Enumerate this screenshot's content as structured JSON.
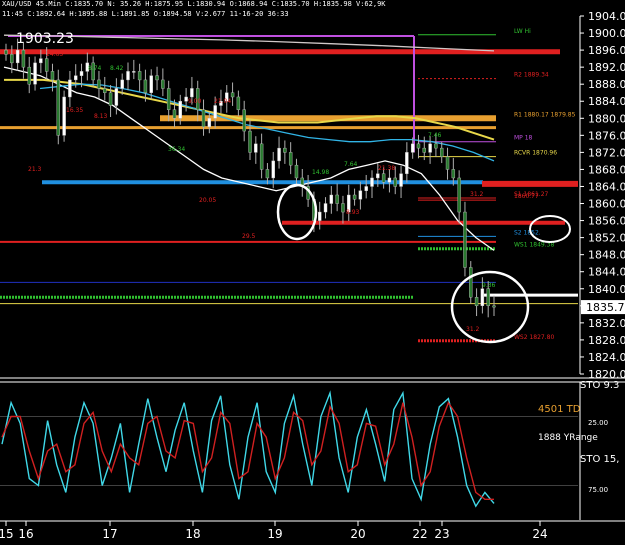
{
  "header": {
    "text": "XAU/USD 45.Min C:1835.70 N: 35.26 H:1875.95 L:1830.94 O:1868.94 C:1835.70 H:1835.98 V:62,9K",
    "subtext": "11:45 C:1892.64 H:1895.88 L:1891.85 O:1894.58 V:2.677 11-16-20 36:33",
    "big_price": "1903.23"
  },
  "colors": {
    "background": "#000000",
    "axis_text": "#ffffff",
    "candle_up": "#ffffff",
    "candle_down": "#ffffff",
    "ma_white": "#ffffff",
    "ma_yellow": "#e8d84a",
    "ma_cyan": "#31b4e6",
    "ma_orange": "#e8a030",
    "ma_purple": "#c050e0",
    "level_red": "#e02020",
    "level_blue": "#2090e0",
    "level_green": "#30c030",
    "osc_cyan": "#40d8e8",
    "osc_red": "#d02020"
  },
  "chart_data": [
    {
      "type": "line",
      "title": "XAU/USD 45.Min",
      "y_ticks": [
        1820.0,
        1824.0,
        1828.0,
        1832.0,
        1836.0,
        1840.0,
        1844.0,
        1848.0,
        1852.0,
        1856.0,
        1860.0,
        1864.0,
        1868.0,
        1872.0,
        1876.0,
        1880.0,
        1884.0,
        1888.0,
        1892.0,
        1896.0,
        1900.0,
        1904.0
      ],
      "ylim": [
        1820,
        1904
      ],
      "last_price": "1835.70",
      "x_ticks": [
        "15",
        "16",
        "17",
        "18",
        "19",
        "20",
        "22",
        "23",
        "24"
      ],
      "series": [
        {
          "style": "candles",
          "values": [
            1895,
            1893,
            1896,
            1892,
            1888,
            1893,
            1894,
            1891,
            1889,
            1876,
            1885,
            1889,
            1890,
            1891,
            1893,
            1889,
            1887,
            1886,
            1883,
            1887,
            1889,
            1891,
            1891,
            1889,
            1886,
            1890,
            1889,
            1887,
            1882,
            1880,
            1884,
            1885,
            1887,
            1882,
            1878,
            1880,
            1883,
            1884,
            1886,
            1885,
            1882,
            1877,
            1872,
            1874,
            1868,
            1866,
            1870,
            1873,
            1872,
            1869,
            1866,
            1864,
            1861,
            1856,
            1858,
            1860,
            1862,
            1860,
            1858,
            1862,
            1861,
            1863,
            1864,
            1866,
            1867,
            1865,
            1866,
            1864,
            1867,
            1872,
            1874,
            1873,
            1872,
            1874,
            1873,
            1871,
            1868,
            1866,
            1858,
            1845,
            1838,
            1836,
            1840,
            1836,
            1835.7
          ]
        },
        {
          "style": "ma_white",
          "values": [
            1892,
            1891,
            1890,
            1888,
            1886,
            1885,
            1883,
            1880,
            1877,
            1874,
            1871,
            1868,
            1866,
            1865,
            1864,
            1863,
            1864,
            1865,
            1866,
            1868,
            1869,
            1870,
            1869,
            1867,
            1862,
            1856,
            1852,
            1849
          ]
        },
        {
          "style": "ma_yellow",
          "values": [
            1889,
            1889,
            1889,
            1888.5,
            1888,
            1887,
            1886,
            1885,
            1884,
            1883,
            1882,
            1881,
            1880,
            1879.5,
            1879,
            1879,
            1879,
            1879.5,
            1880,
            1880.5,
            1880.5,
            1880,
            1879,
            1878,
            1876.5,
            1875
          ]
        },
        {
          "style": "ma_cyan",
          "values": [
            1887,
            1887.5,
            1888,
            1887.8,
            1887,
            1886,
            1884.5,
            1883,
            1881.5,
            1880,
            1878.5,
            1877.5,
            1876.5,
            1875.5,
            1875,
            1874.5,
            1874.5,
            1875,
            1875,
            1874.5,
            1873.5,
            1872,
            1870
          ]
        },
        {
          "style": "ma_gray",
          "values": [
            1899.5,
            1899.3,
            1899,
            1898.7,
            1898.4,
            1898,
            1897.5,
            1897,
            1896.4,
            1895.8
          ]
        }
      ],
      "levels": [
        {
          "label": "LW Hi",
          "value": 1899.6
        },
        {
          "label": "",
          "value": 1895.6
        },
        {
          "label": "R2 1889.34",
          "value": 1889.3
        },
        {
          "label": "R1 1880.17  1879.85",
          "value": 1880.0
        },
        {
          "label": "",
          "value": 1877.8
        },
        {
          "label": "MP 18",
          "value": 1874.5
        },
        {
          "label": "RCVR 1870.96",
          "value": 1871.0
        },
        {
          "label": "",
          "value": 1865.0
        },
        {
          "label": "S1 1861.27",
          "value": 1861.3
        },
        {
          "label": "1860.77",
          "value": 1860.8
        },
        {
          "label": "",
          "value": 1855.5
        },
        {
          "label": "S2 1852.",
          "value": 1852.3
        },
        {
          "label": "",
          "value": 1851.0
        },
        {
          "label": "WS1 1849.38",
          "value": 1849.4
        },
        {
          "label": "",
          "value": 1841.5
        },
        {
          "label": "",
          "value": 1838.0
        },
        {
          "label": "",
          "value": 1836.5
        },
        {
          "label": "WS2 1827.80",
          "value": 1827.8
        }
      ],
      "annotations": [
        "24.63",
        "8.74",
        "8.42",
        "16.35",
        "21.3",
        "8.13",
        "9.00",
        "21.04",
        "36.34",
        "20.05",
        "29.5",
        "14.98",
        "7.64",
        "8.93",
        "21.38",
        "7.46",
        "31.2",
        "9.36",
        "31.2"
      ]
    },
    {
      "type": "line",
      "title": "STO",
      "labels": [
        "STO 9.3",
        "4501 TD",
        "1888 YRange",
        "STO 15,",
        "25.00",
        "75.00"
      ],
      "ylim": [
        0,
        100
      ],
      "series": [
        {
          "name": "fast",
          "values": [
            55,
            85,
            70,
            30,
            25,
            72,
            40,
            20,
            60,
            85,
            70,
            25,
            45,
            70,
            20,
            55,
            88,
            60,
            35,
            65,
            85,
            50,
            20,
            72,
            90,
            40,
            15,
            60,
            85,
            35,
            20,
            70,
            90,
            55,
            25,
            75,
            92,
            45,
            20,
            60,
            80,
            55,
            28,
            80,
            92,
            30,
            15,
            55,
            82,
            88,
            60,
            25,
            10,
            20,
            12
          ]
        },
        {
          "name": "slow",
          "values": [
            60,
            75,
            75,
            50,
            30,
            50,
            55,
            35,
            40,
            70,
            78,
            50,
            35,
            55,
            45,
            40,
            70,
            75,
            50,
            45,
            72,
            70,
            35,
            45,
            78,
            70,
            30,
            35,
            70,
            60,
            30,
            45,
            78,
            72,
            40,
            50,
            82,
            70,
            35,
            40,
            70,
            68,
            40,
            55,
            85,
            60,
            25,
            35,
            68,
            85,
            75,
            45,
            20,
            15,
            15
          ]
        }
      ]
    }
  ]
}
